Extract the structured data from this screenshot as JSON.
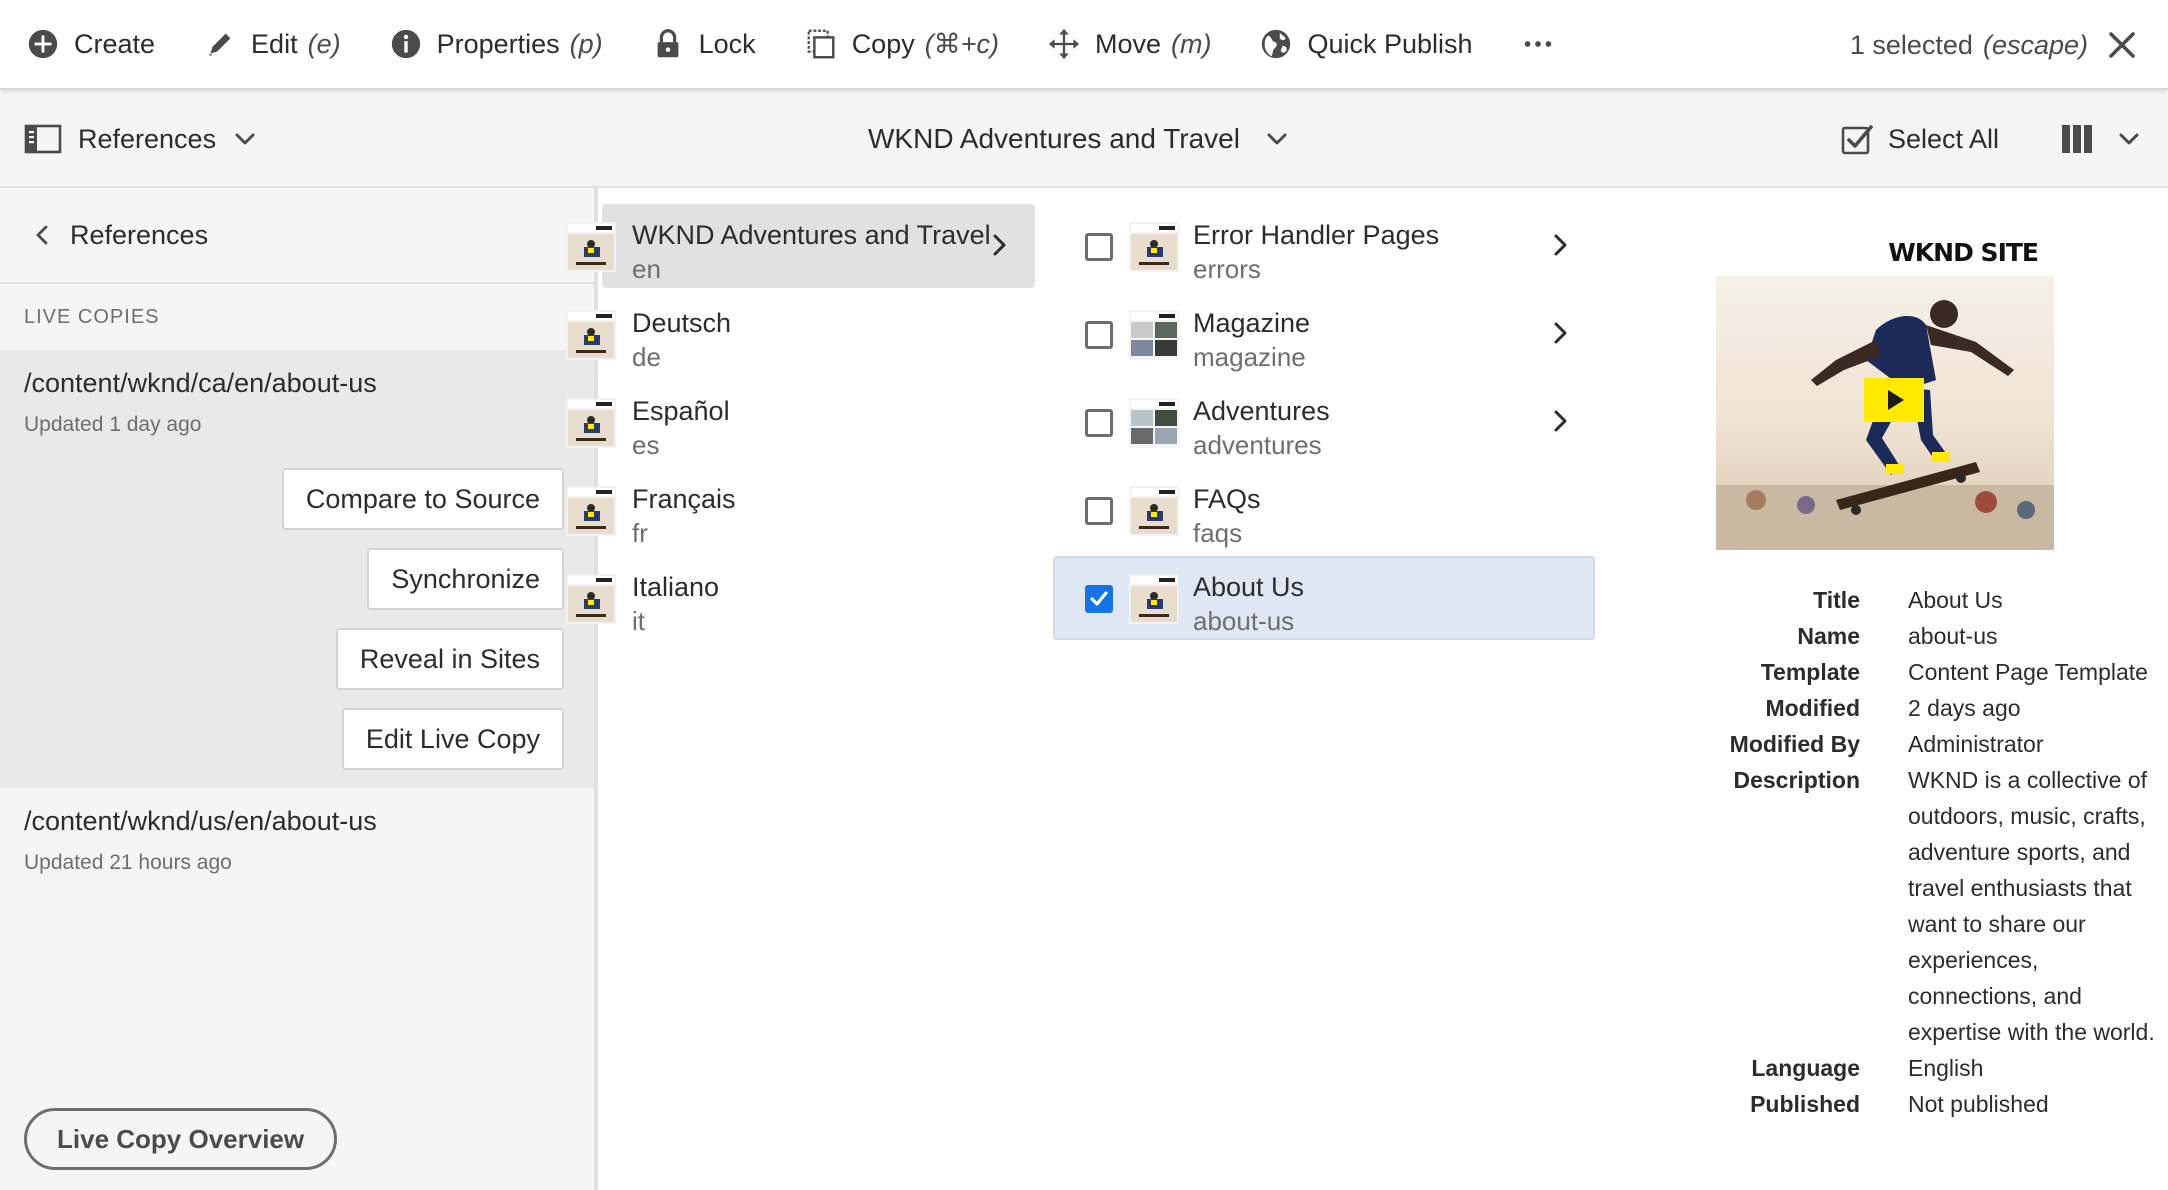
{
  "actions": {
    "create": "Create",
    "edit": "Edit",
    "edit_key": "(e)",
    "properties": "Properties",
    "properties_key": "(p)",
    "lock": "Lock",
    "copy": "Copy",
    "copy_key": "(⌘+c)",
    "move": "Move",
    "move_key": "(m)",
    "quick_publish": "Quick Publish",
    "selection_count": "1 selected",
    "selection_key": "(escape)"
  },
  "toolbar": {
    "rail_label": "References",
    "site_title": "WKND Adventures and Travel",
    "select_all": "Select All"
  },
  "rail": {
    "back_label": "References",
    "section_label": "LIVE COPIES",
    "live_copies": [
      {
        "path": "/content/wknd/ca/en/about-us",
        "updated": "Updated 1 day ago"
      },
      {
        "path": "/content/wknd/us/en/about-us",
        "updated": "Updated 21 hours ago"
      }
    ],
    "buttons": {
      "compare": "Compare to Source",
      "synchronize": "Synchronize",
      "reveal": "Reveal in Sites",
      "edit_live_copy": "Edit Live Copy"
    },
    "overview_button": "Live Copy Overview"
  },
  "column1": [
    {
      "title": "WKND Adventures and Travel",
      "name": "en"
    },
    {
      "title": "Deutsch",
      "name": "de"
    },
    {
      "title": "Español",
      "name": "es"
    },
    {
      "title": "Français",
      "name": "fr"
    },
    {
      "title": "Italiano",
      "name": "it"
    }
  ],
  "column2": [
    {
      "title": "Error Handler Pages",
      "name": "errors",
      "checked": false
    },
    {
      "title": "Magazine",
      "name": "magazine",
      "checked": false
    },
    {
      "title": "Adventures",
      "name": "adventures",
      "checked": false
    },
    {
      "title": "FAQs",
      "name": "faqs",
      "checked": false
    },
    {
      "title": "About Us",
      "name": "about-us",
      "checked": true
    }
  ],
  "preview": {
    "brand": "WKND SITE",
    "labels": {
      "title": "Title",
      "name": "Name",
      "template": "Template",
      "modified": "Modified",
      "modified_by": "Modified By",
      "description": "Description",
      "language": "Language",
      "published": "Published"
    },
    "values": {
      "title": "About Us",
      "name": "about-us",
      "template": "Content Page Template",
      "modified": "2 days ago",
      "modified_by": "Administrator",
      "description": "WKND is a collective of outdoors, music, crafts, adventure sports, and travel enthusiasts that want to share our experiences, connections, and expertise with the world.",
      "language": "English",
      "published": "Not published"
    }
  },
  "colors": {
    "accent": "#1473e6",
    "selected_row": "#dfe7f2",
    "active_row": "#e1e1e1",
    "rail_bg": "#f5f5f5",
    "brand_yellow": "#ffea00"
  }
}
